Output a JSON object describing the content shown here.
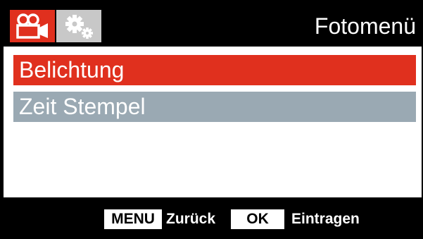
{
  "header": {
    "title": "Fotomenü",
    "tabs": [
      {
        "icon": "movie-camera-icon",
        "active": true
      },
      {
        "icon": "gears-icon",
        "active": false
      }
    ]
  },
  "menu": {
    "items": [
      {
        "label": "Belichtung",
        "selected": true
      },
      {
        "label": "Zeit Stempel",
        "selected": false
      }
    ]
  },
  "footer": {
    "menu_key": "MENU",
    "menu_action": "Zurück",
    "ok_key": "OK",
    "ok_action": "Eintragen"
  },
  "colors": {
    "accent": "#e0301e",
    "inactive_item": "#9aa9b3",
    "inactive_tab": "#c8c8c8",
    "bar": "#000000"
  }
}
